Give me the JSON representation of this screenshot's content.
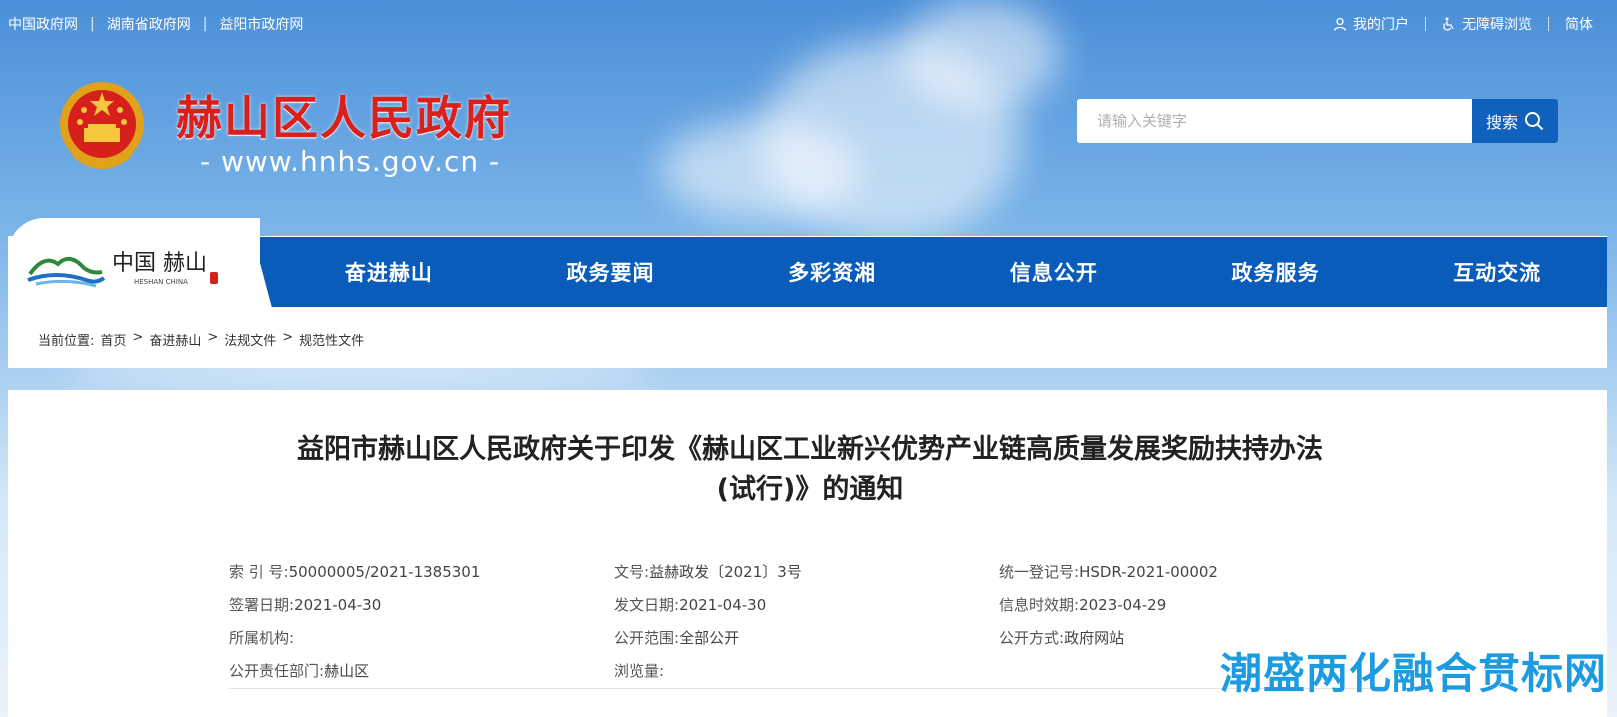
{
  "top_links": [
    "中国政府网",
    "湖南省政府网",
    "益阳市政府网"
  ],
  "top_separator": "|",
  "top_right": {
    "portal": "我的门户",
    "accessibility": "无障碍浏览",
    "language": "简体"
  },
  "site": {
    "title": "赫山区人民政府",
    "url": "- www.hnhs.gov.cn -"
  },
  "brand": {
    "cn": "中国 赫山",
    "en": "HESHAN  CHINA"
  },
  "search": {
    "placeholder": "请输入关键字",
    "button": "搜索"
  },
  "nav": [
    "奋进赫山",
    "政务要闻",
    "多彩资湘",
    "信息公开",
    "政务服务",
    "互动交流"
  ],
  "breadcrumb": {
    "label": "当前位置:",
    "items": [
      "首页",
      "奋进赫山",
      "法规文件",
      "规范性文件"
    ],
    "sep": ">"
  },
  "doc": {
    "title_line1": "益阳市赫山区人民政府关于印发《赫山区工业新兴优势产业链高质量发展奖励扶持办法",
    "title_line2": "(试行)》的通知"
  },
  "meta": {
    "index_label": "索 引 号:",
    "index_value": "50000005/2021-1385301",
    "docno_label": "文号:",
    "docno_value": "益赫政发〔2021〕3号",
    "reg_label": "统一登记号:",
    "reg_value": "HSDR-2021-00002",
    "sign_label": "签署日期:",
    "sign_value": "2021-04-30",
    "issue_label": "发文日期:",
    "issue_value": "2021-04-30",
    "valid_label": "信息时效期:",
    "valid_value": "2023-04-29",
    "org_label": "所属机构:",
    "org_value": "",
    "scope_label": "公开范围:",
    "scope_value": "全部公开",
    "method_label": "公开方式:",
    "method_value": "政府网站",
    "dept_label": "公开责任部门:",
    "dept_value": "赫山区",
    "views_label": "浏览量:",
    "views_value": ""
  },
  "watermark": "潮盛两化融合贯标网",
  "colors": {
    "nav_blue": "#0a5cba",
    "title_red": "#d9201c",
    "search_button": "#1061be"
  }
}
